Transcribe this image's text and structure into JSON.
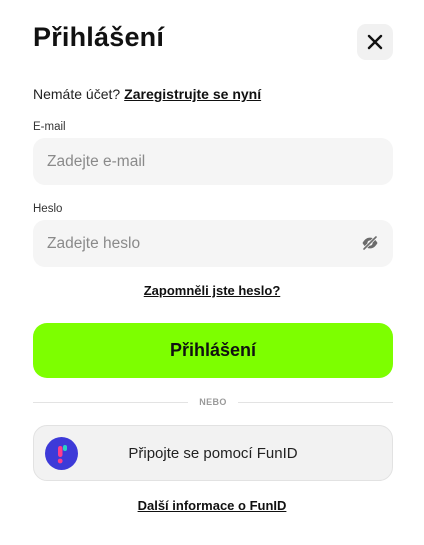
{
  "dialog": {
    "title": "Přihlášení"
  },
  "register": {
    "prompt": "Nemáte účet?",
    "link_label": "Zaregistrujte se nyní"
  },
  "email": {
    "label": "E-mail",
    "placeholder": "Zadejte e-mail",
    "value": ""
  },
  "password": {
    "label": "Heslo",
    "placeholder": "Zadejte heslo",
    "value": ""
  },
  "forgot_label": "Zapomněli jste heslo?",
  "login_button_label": "Přihlášení",
  "divider_label": "NEBO",
  "funid": {
    "button_label": "Připojte se pomocí FunID",
    "info_link_label": "Další informace o FunID"
  },
  "colors": {
    "accent": "#7dff00",
    "funid_brand": "#3d3ad8"
  },
  "icons": {
    "close": "close-icon",
    "password_visibility": "eye-off-icon",
    "funid_logo": "funid-logo-icon"
  }
}
